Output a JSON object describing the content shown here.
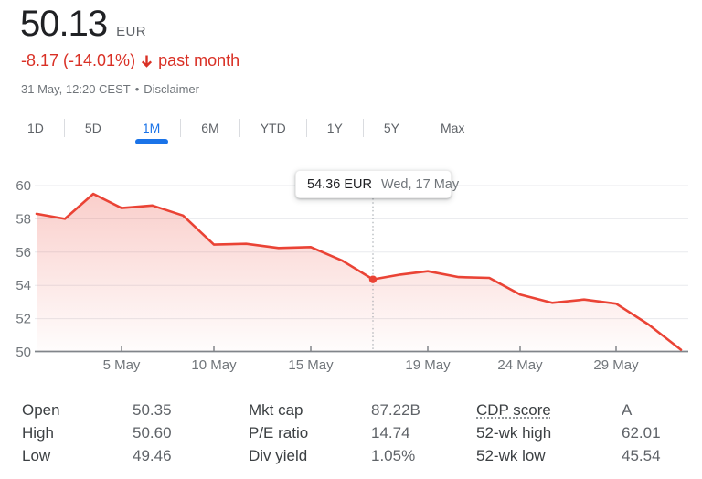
{
  "header": {
    "price": "50.13",
    "currency": "EUR",
    "change": "-8.17 (-14.01%)",
    "change_period": "past month",
    "timestamp": "31 May, 12:20 CEST",
    "separator": "•",
    "disclaimer": "Disclaimer"
  },
  "tabs": {
    "items": [
      {
        "label": "1D",
        "active": false
      },
      {
        "label": "5D",
        "active": false
      },
      {
        "label": "1M",
        "active": true
      },
      {
        "label": "6M",
        "active": false
      },
      {
        "label": "YTD",
        "active": false
      },
      {
        "label": "1Y",
        "active": false
      },
      {
        "label": "5Y",
        "active": false
      },
      {
        "label": "Max",
        "active": false
      }
    ]
  },
  "chart_data": {
    "type": "line",
    "title": "Stock price, past month",
    "currency": "EUR",
    "ylim": [
      50,
      60
    ],
    "y_ticks": [
      60,
      58,
      56,
      54,
      52,
      50
    ],
    "x_tick_labels": [
      "5 May",
      "10 May",
      "15 May",
      "19 May",
      "24 May",
      "29 May"
    ],
    "grid": true,
    "points": [
      {
        "date": "2 May",
        "value": 58.3
      },
      {
        "date": "3 May",
        "value": 58.0
      },
      {
        "date": "4 May",
        "value": 59.5
      },
      {
        "date": "5 May",
        "value": 58.65
      },
      {
        "date": "8 May",
        "value": 58.8
      },
      {
        "date": "9 May",
        "value": 58.2
      },
      {
        "date": "10 May",
        "value": 56.45
      },
      {
        "date": "11 May",
        "value": 56.5
      },
      {
        "date": "12 May",
        "value": 56.25
      },
      {
        "date": "15 May",
        "value": 56.3
      },
      {
        "date": "16 May",
        "value": 55.5
      },
      {
        "date": "17 May",
        "value": 54.36
      },
      {
        "date": "18 May",
        "value": 54.65
      },
      {
        "date": "19 May",
        "value": 54.85
      },
      {
        "date": "22 May",
        "value": 54.5
      },
      {
        "date": "23 May",
        "value": 54.45
      },
      {
        "date": "24 May",
        "value": 53.45
      },
      {
        "date": "25 May",
        "value": 52.95
      },
      {
        "date": "26 May",
        "value": 53.15
      },
      {
        "date": "29 May",
        "value": 52.9
      },
      {
        "date": "30 May",
        "value": 51.65
      },
      {
        "date": "31 May",
        "value": 50.13
      }
    ],
    "highlight": {
      "date": "17 May",
      "value": 54.36,
      "price_label": "54.36 EUR",
      "date_label": "Wed, 17 May"
    },
    "colors": {
      "line": "#ea4335",
      "negative_text": "#d93025",
      "active_tab": "#1a73e8"
    }
  },
  "stats": {
    "columns": [
      {
        "rows": [
          {
            "label": "Open",
            "value": "50.35"
          },
          {
            "label": "High",
            "value": "50.60"
          },
          {
            "label": "Low",
            "value": "49.46"
          }
        ]
      },
      {
        "rows": [
          {
            "label": "Mkt cap",
            "value": "87.22B"
          },
          {
            "label": "P/E ratio",
            "value": "14.74"
          },
          {
            "label": "Div yield",
            "value": "1.05%"
          }
        ]
      },
      {
        "rows": [
          {
            "label": "CDP score",
            "value": "A",
            "dotted": true
          },
          {
            "label": "52-wk high",
            "value": "62.01"
          },
          {
            "label": "52-wk low",
            "value": "45.54"
          }
        ]
      }
    ]
  }
}
